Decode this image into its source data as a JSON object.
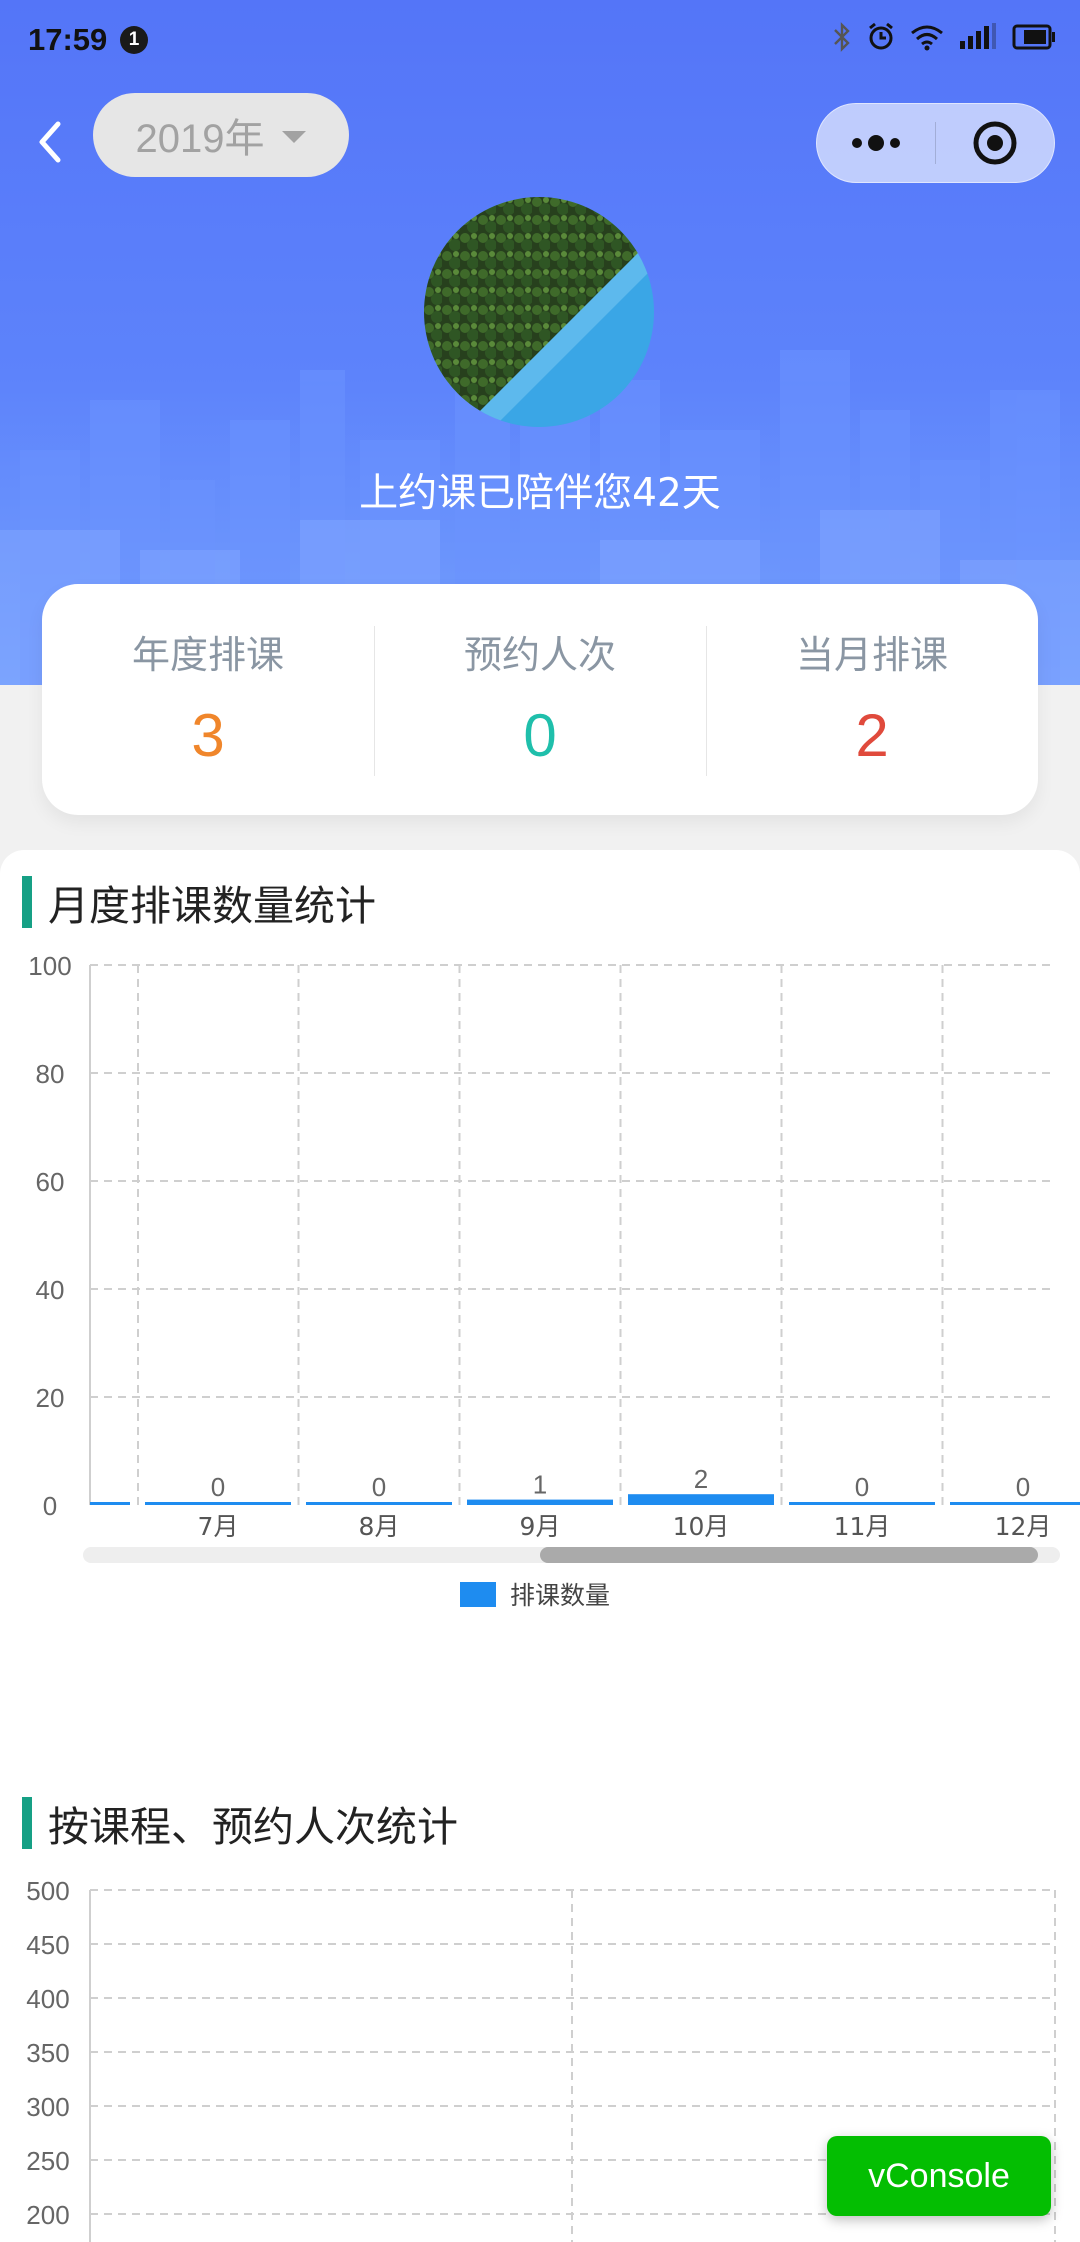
{
  "status_bar": {
    "time": "17:59",
    "notification_count": "1",
    "battery_icon": "battery-icon"
  },
  "nav": {
    "year": "2019年",
    "back_icon": "back-arrow-icon",
    "more_icon": "more-dots-icon",
    "close_icon": "mini-program-close-icon"
  },
  "profile": {
    "tagline": "上约课已陪伴您42天",
    "avatar_icon": "avatar-forest-lake-photo"
  },
  "stats": [
    {
      "label": "年度排课",
      "value": "3",
      "color": "#f0862b"
    },
    {
      "label": "预约人次",
      "value": "0",
      "color": "#1fbfab"
    },
    {
      "label": "当月排课",
      "value": "2",
      "color": "#e04a3c"
    }
  ],
  "monthly_section": {
    "title": "月度排课数量统计"
  },
  "course_section": {
    "title": "按课程、预约人次统计"
  },
  "chart_data": [
    {
      "type": "bar",
      "title": "月度排课数量统计",
      "categories": [
        "7月",
        "8月",
        "9月",
        "10月",
        "11月",
        "12月"
      ],
      "series": [
        {
          "name": "排课数量",
          "values": [
            0,
            0,
            1,
            2,
            0,
            0
          ],
          "color": "#1e8cf0"
        }
      ],
      "ylim": [
        0,
        100
      ],
      "yticks": [
        0,
        20,
        40,
        60,
        80,
        100
      ],
      "grid": true,
      "legend": "bottom",
      "data_labels": true,
      "scrollbar": true
    },
    {
      "type": "bar",
      "title": "按课程、预约人次统计",
      "categories": [],
      "series": [],
      "ylim": [
        200,
        500
      ],
      "yticks": [
        200,
        250,
        300,
        350,
        400,
        450,
        500
      ],
      "grid": true
    }
  ],
  "vconsole": {
    "label": "vConsole"
  }
}
